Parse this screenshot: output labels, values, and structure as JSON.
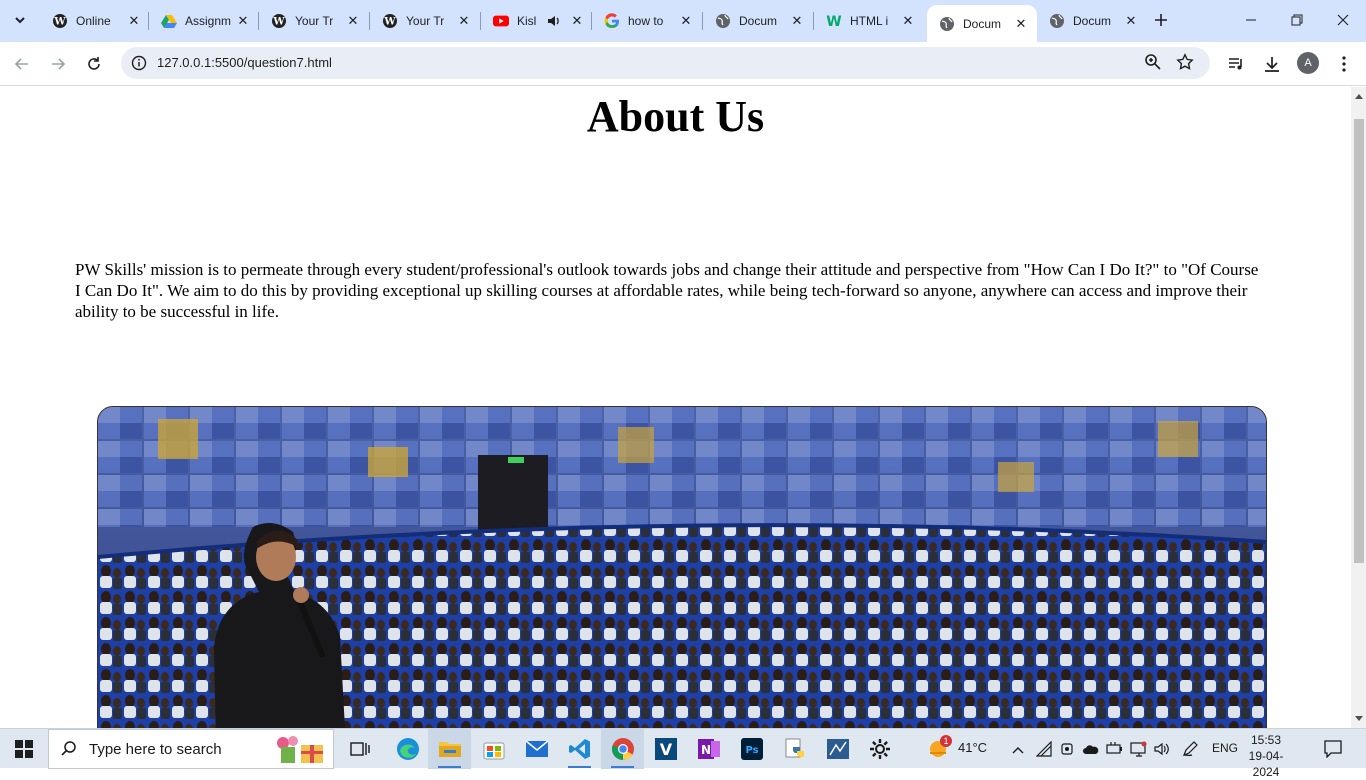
{
  "browser": {
    "tabs": [
      {
        "title": "Online",
        "icon": "wordpress"
      },
      {
        "title": "Assignm",
        "icon": "google-drive"
      },
      {
        "title": "Your Tr",
        "icon": "wordpress"
      },
      {
        "title": "Your Tr",
        "icon": "wordpress"
      },
      {
        "title": "Kisl",
        "icon": "youtube"
      },
      {
        "title": "how to",
        "icon": "google"
      },
      {
        "title": "Docum",
        "icon": "globe"
      },
      {
        "title": "HTML i",
        "icon": "w3schools"
      },
      {
        "title": "Docum",
        "icon": "globe"
      },
      {
        "title": "Docum",
        "icon": "globe"
      }
    ],
    "active_tab_index": 8,
    "address": "127.0.0.1:5500/question7.html",
    "profile_initial": "A"
  },
  "page": {
    "heading": "About Us",
    "mission": "PW Skills' mission is to permeate through every student/professional's outlook towards jobs and change their attitude and perspective from \"How Can I Do It?\" to \"Of Course I Can Do It\". We aim to do this by providing exceptional up skilling courses at affordable rates, while being tech-forward so anyone, anywhere can access and improve their ability to be successful in life."
  },
  "taskbar": {
    "search_placeholder": "Type here to search",
    "weather": "41°C",
    "weather_badge": "1",
    "language": "ENG",
    "time": "15:53",
    "date": "19-04-2024"
  },
  "colors": {
    "tabstrip": "#d3e3fd",
    "omnibox": "#e9eef6",
    "taskbar": "#dfe8f0"
  }
}
